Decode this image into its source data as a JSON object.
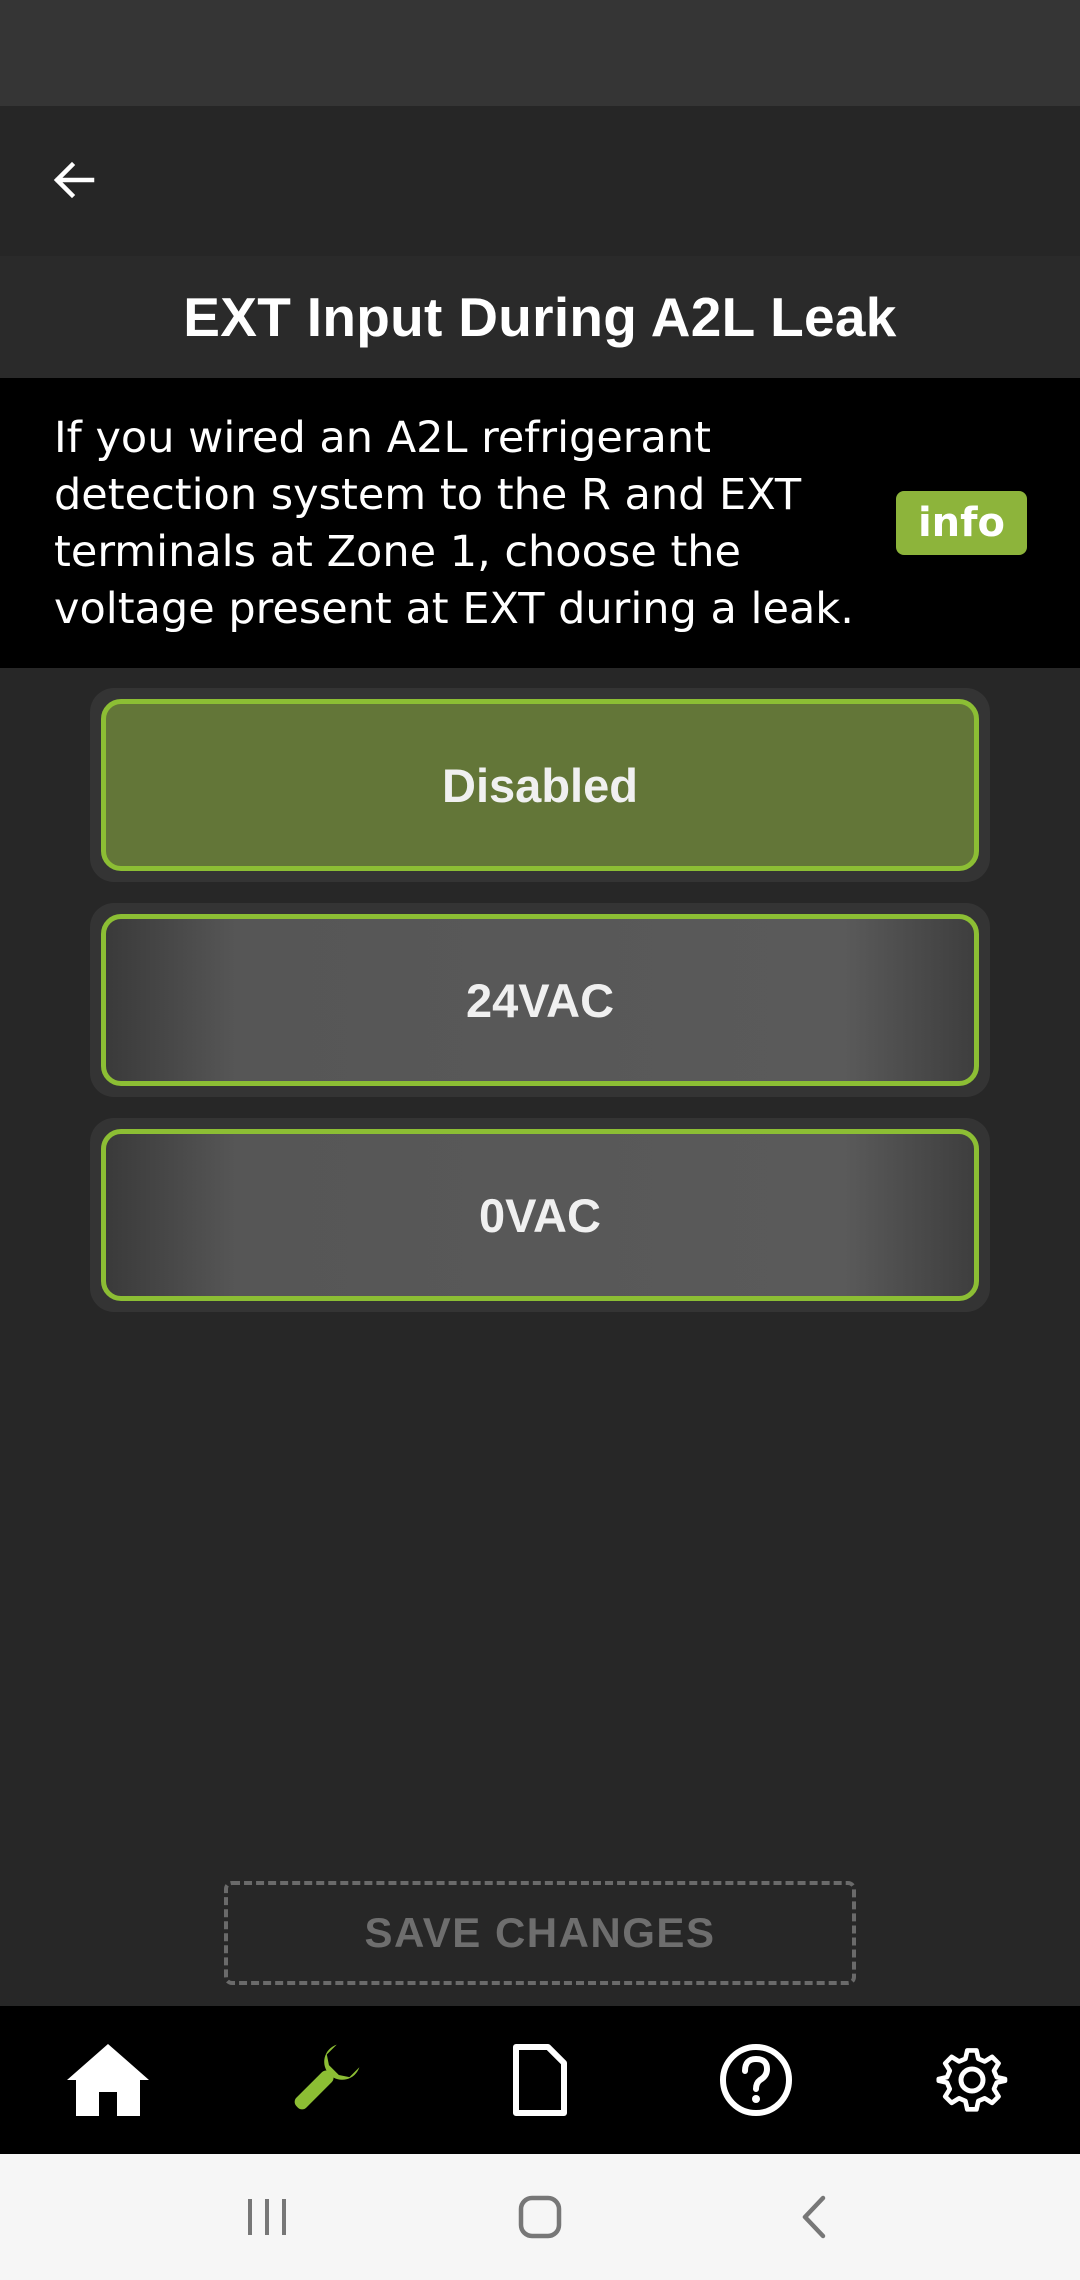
{
  "header": {
    "title": "EXT Input During A2L Leak"
  },
  "description": {
    "lines": [
      "If you wired an A2L refrigerant",
      "detection system to the R and EXT",
      "terminals at Zone 1, choose the",
      "voltage present at EXT during a leak."
    ],
    "info_label": "info"
  },
  "options": [
    {
      "label": "Disabled",
      "selected": true
    },
    {
      "label": "24VAC",
      "selected": false
    },
    {
      "label": "0VAC",
      "selected": false
    }
  ],
  "save_label": "SAVE CHANGES",
  "bottom_nav": {
    "items": [
      {
        "icon": "home-icon",
        "active": false
      },
      {
        "icon": "wrench-icon",
        "active": true
      },
      {
        "icon": "document-icon",
        "active": false
      },
      {
        "icon": "help-icon",
        "active": false
      },
      {
        "icon": "gear-icon",
        "active": false
      }
    ]
  },
  "system_nav": {
    "items": [
      "recents-icon",
      "home-circle-icon",
      "back-chevron-icon"
    ]
  },
  "colors": {
    "accent": "#8db43b",
    "selected_option": "#637638",
    "active_nav": "#8cbe34",
    "background": "#272727"
  }
}
